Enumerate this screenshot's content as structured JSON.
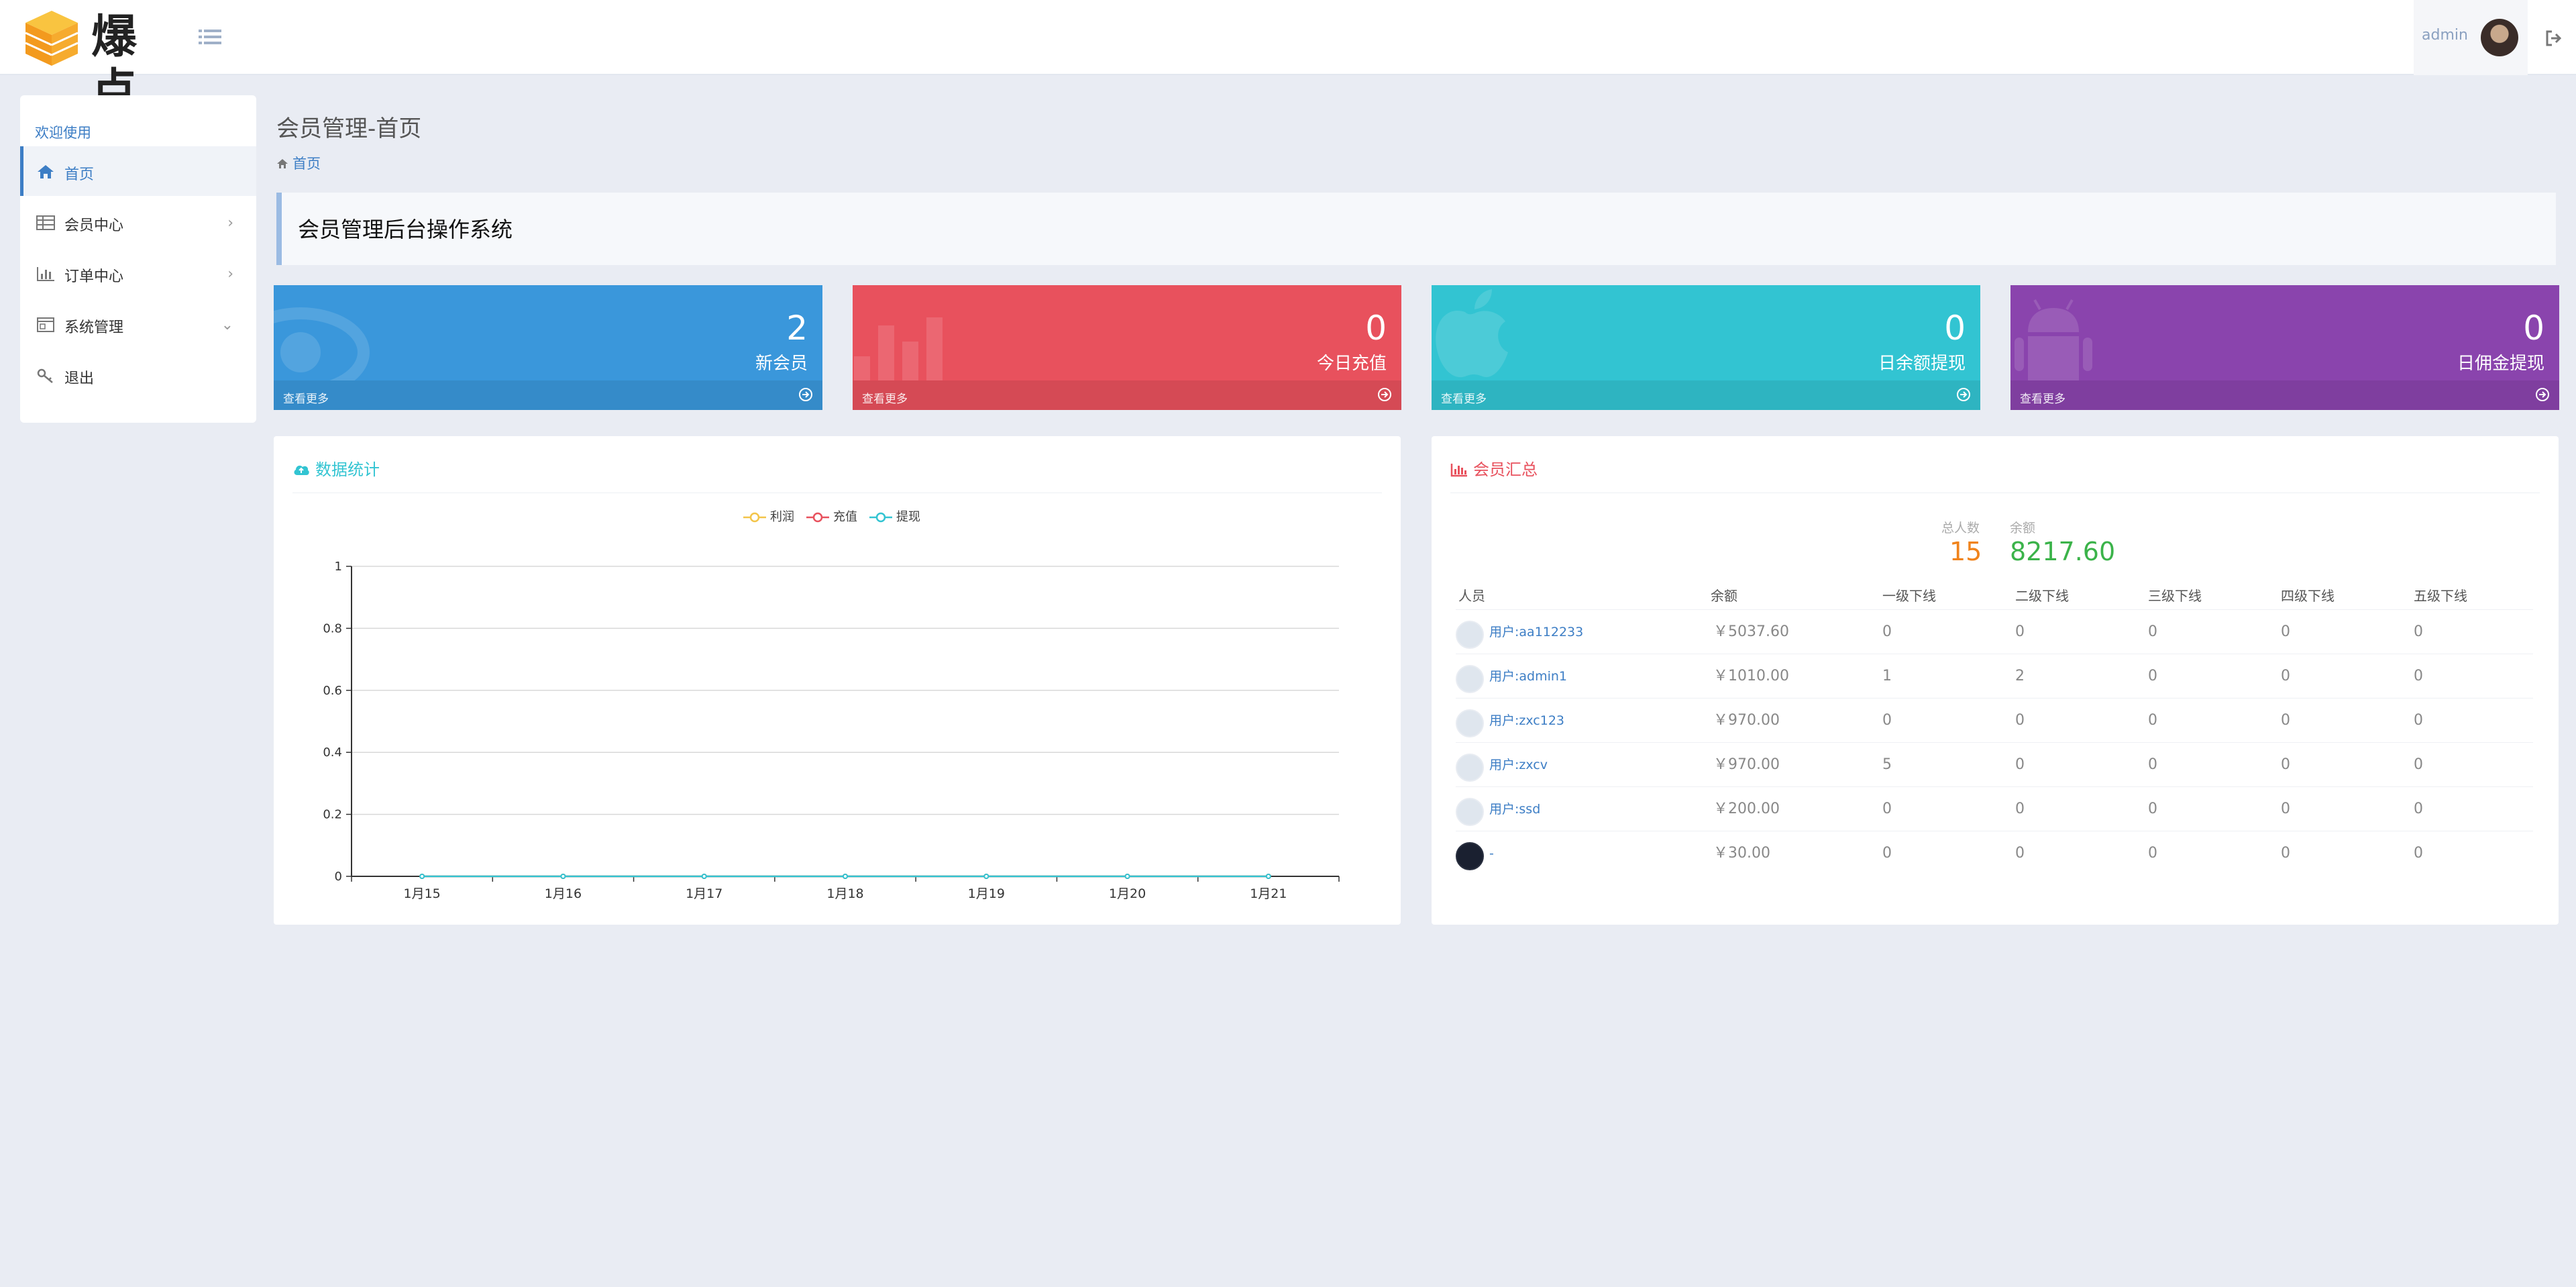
{
  "app": {
    "logo_text": "爆点",
    "user_name": "admin"
  },
  "sidebar": {
    "welcome": "欢迎使用",
    "items": [
      {
        "label": "首页",
        "icon": "home-icon",
        "chevron": ""
      },
      {
        "label": "会员中心",
        "icon": "table-icon",
        "chevron": "›"
      },
      {
        "label": "订单中心",
        "icon": "bar-chart-icon",
        "chevron": "›"
      },
      {
        "label": "系统管理",
        "icon": "settings-window-icon",
        "chevron": "⌄"
      },
      {
        "label": "退出",
        "icon": "key-icon",
        "chevron": ""
      }
    ]
  },
  "header": {
    "page_title": "会员管理-首页",
    "breadcrumb": "首页",
    "banner": "会员管理后台操作系统"
  },
  "stats": [
    {
      "value": "2",
      "caption": "新会员",
      "more": "查看更多",
      "color": "#3a97db"
    },
    {
      "value": "0",
      "caption": "今日充值",
      "more": "查看更多",
      "color": "#e8515d"
    },
    {
      "value": "0",
      "caption": "日余额提现",
      "more": "查看更多",
      "color": "#32c4d2"
    },
    {
      "value": "0",
      "caption": "日佣金提现",
      "more": "查看更多",
      "color": "#8a44ad"
    }
  ],
  "data_panel": {
    "title": "数据统计",
    "title_color": "#32c4d2"
  },
  "chart_data": {
    "type": "line",
    "categories": [
      "1月15",
      "1月16",
      "1月17",
      "1月18",
      "1月19",
      "1月20",
      "1月21"
    ],
    "series": [
      {
        "name": "利润",
        "values": [
          0,
          0,
          0,
          0,
          0,
          0,
          0
        ],
        "color": "#f3c54a"
      },
      {
        "name": "充值",
        "values": [
          0,
          0,
          0,
          0,
          0,
          0,
          0
        ],
        "color": "#e8515d"
      },
      {
        "name": "提现",
        "values": [
          0,
          0,
          0,
          0,
          0,
          0,
          0
        ],
        "color": "#32c4d2"
      }
    ],
    "ylim": [
      0,
      1
    ],
    "yticks": [
      0,
      0.2,
      0.4,
      0.6,
      0.8,
      1
    ],
    "ytick_labels": [
      "0",
      "0.2",
      "0.4",
      "0.6",
      "0.8",
      "1"
    ],
    "grid": true,
    "legend": "top-center"
  },
  "member_panel": {
    "title": "会员汇总",
    "title_color": "#e8515d",
    "total_label": "总人数",
    "total_value": "15",
    "balance_label": "余额",
    "balance_value": "8217.60",
    "columns": [
      "人员",
      "余额",
      "一级下线",
      "二级下线",
      "三级下线",
      "四级下线",
      "五级下线"
    ],
    "rows": [
      {
        "user": "用户:aa112233",
        "balance": "￥5037.60",
        "l1": "0",
        "l2": "0",
        "l3": "0",
        "l4": "0",
        "l5": "0",
        "avatar": "light"
      },
      {
        "user": "用户:admin1",
        "balance": "￥1010.00",
        "l1": "1",
        "l2": "2",
        "l3": "0",
        "l4": "0",
        "l5": "0",
        "avatar": "light"
      },
      {
        "user": "用户:zxc123",
        "balance": "￥970.00",
        "l1": "0",
        "l2": "0",
        "l3": "0",
        "l4": "0",
        "l5": "0",
        "avatar": "light"
      },
      {
        "user": "用户:zxcv",
        "balance": "￥970.00",
        "l1": "5",
        "l2": "0",
        "l3": "0",
        "l4": "0",
        "l5": "0",
        "avatar": "light"
      },
      {
        "user": "用户:ssd",
        "balance": "￥200.00",
        "l1": "0",
        "l2": "0",
        "l3": "0",
        "l4": "0",
        "l5": "0",
        "avatar": "light"
      },
      {
        "user": "-",
        "balance": "￥30.00",
        "l1": "0",
        "l2": "0",
        "l3": "0",
        "l4": "0",
        "l5": "0",
        "avatar": "dark"
      }
    ]
  }
}
